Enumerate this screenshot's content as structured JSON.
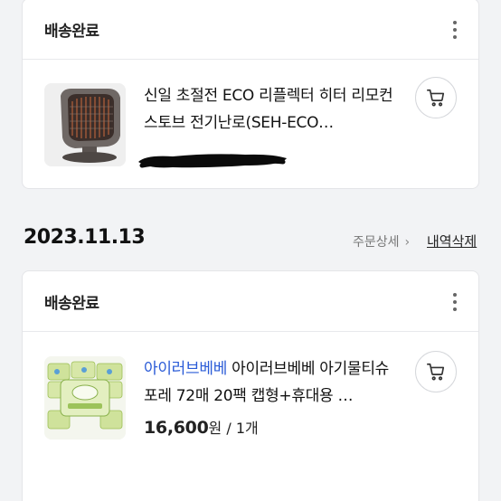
{
  "orders": [
    {
      "status": "배송완료",
      "product_title": "신일 초절전 ECO 리플렉터 히터 리모컨 스토브 전기난로(SEH-ECO…",
      "thumb_icon": "heater-image",
      "cart_icon": "cart-icon"
    },
    {
      "date": "2023.11.13",
      "detail_label": "주문상세",
      "detail_chevron": "›",
      "delete_label": "내역삭제",
      "status": "배송완료",
      "brand": "아이러브베베",
      "product_title": " 아이러브베베 아기물티슈 포레 72매 20팩 캡형+휴대용 …",
      "price": "16,600",
      "price_unit": "원",
      "quantity": " / 1개",
      "thumb_icon": "baby-wipes-image",
      "cart_icon": "cart-icon"
    }
  ],
  "colors": {
    "background": "#f2f3f5",
    "brand_link": "#2a5bd7",
    "card_border": "#e4e5e8"
  }
}
